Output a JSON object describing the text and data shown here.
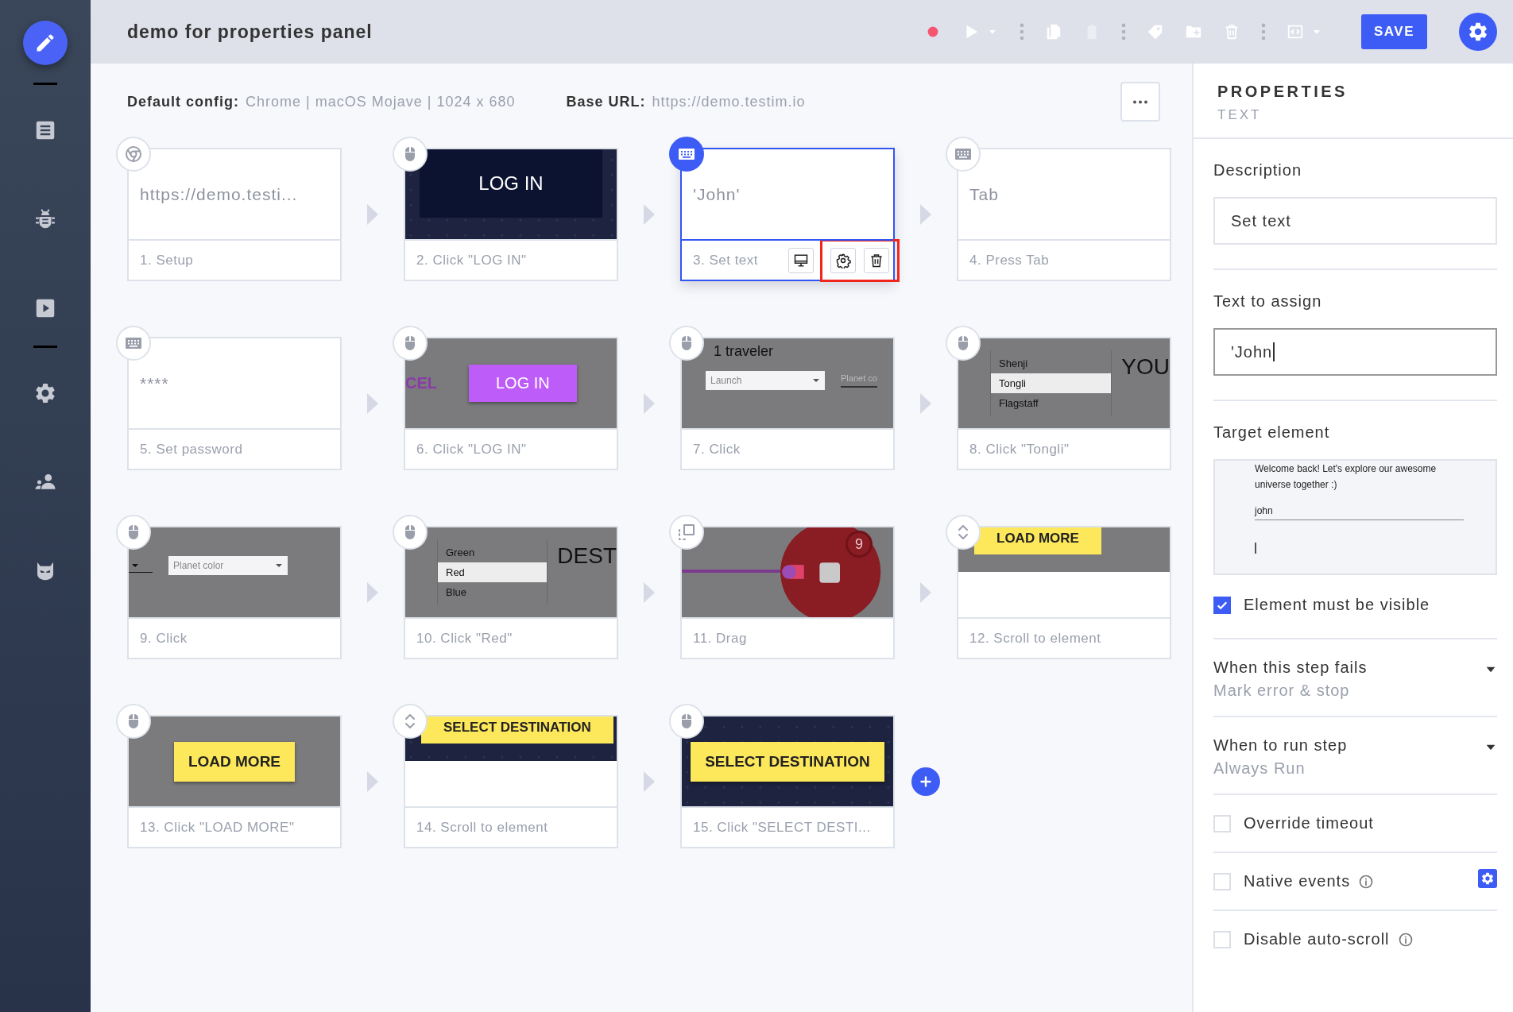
{
  "sidebar": {
    "groups": [
      [
        {
          "kind": "edit",
          "selected": true
        }
      ],
      [
        {
          "kind": "list",
          "selected": false
        },
        {
          "kind": "bug",
          "selected": false
        },
        {
          "kind": "run",
          "selected": false
        }
      ],
      [
        {
          "kind": "settings",
          "selected": false
        },
        {
          "kind": "team",
          "selected": false
        },
        {
          "kind": "mask",
          "selected": false
        }
      ]
    ]
  },
  "header": {
    "title": "demo for properties panel",
    "toolbar": [
      {
        "kind": "record",
        "disabled": false
      },
      {
        "kind": "play",
        "disabled": false
      },
      {
        "kind": "caret",
        "disabled": false
      },
      {
        "kind": "dots",
        "disabled": false
      },
      {
        "kind": "copy",
        "disabled": false
      },
      {
        "kind": "paste",
        "disabled": true
      },
      {
        "kind": "dots",
        "disabled": false
      },
      {
        "kind": "tag",
        "disabled": false
      },
      {
        "kind": "folder-add",
        "disabled": false
      },
      {
        "kind": "trash",
        "disabled": false
      },
      {
        "kind": "dots",
        "disabled": false
      },
      {
        "kind": "code",
        "disabled": false
      },
      {
        "kind": "caret",
        "disabled": false
      }
    ],
    "save_button": "SAVE",
    "properties_toggle": {
      "selected": true
    }
  },
  "config": {
    "default_label": "Default config:",
    "default_value": "Chrome | macOS Mojave | 1024 x 680",
    "base_label": "Base URL:",
    "base_value": "https://demo.testim.io"
  },
  "steps": [
    {
      "label": "1. Setup",
      "kind": "browser",
      "selected": false,
      "preview": {
        "kind": "text",
        "text": "https://demo.testi..."
      }
    },
    {
      "label": "2. Click \"LOG IN\"",
      "kind": "click",
      "selected": false,
      "preview": {
        "kind": "login_night",
        "button": "LOG IN"
      }
    },
    {
      "label": "3. Set text",
      "kind": "typing",
      "selected": true,
      "highlight_actions": true,
      "preview": {
        "kind": "text",
        "text": "'John'"
      }
    },
    {
      "label": "4. Press Tab",
      "kind": "typing",
      "selected": false,
      "preview": {
        "kind": "text",
        "text": "Tab"
      }
    },
    {
      "label": "5. Set password",
      "kind": "typing",
      "selected": false,
      "preview": {
        "kind": "text",
        "text": "****"
      }
    },
    {
      "label": "6. Click \"LOG IN\"",
      "kind": "click",
      "selected": false,
      "preview": {
        "kind": "login_purple",
        "side_text": "CEL",
        "button": "LOG IN"
      }
    },
    {
      "label": "7. Click",
      "kind": "click",
      "selected": false,
      "preview": {
        "kind": "form",
        "title": "1 traveler",
        "select": "Launch",
        "side_text": "Planet co",
        "cut_select": false
      }
    },
    {
      "label": "8. Click \"Tongli\"",
      "kind": "click",
      "selected": false,
      "preview": {
        "kind": "dropdown",
        "items": [
          {
            "text": "Shenji",
            "selected": false
          },
          {
            "text": "Tongli",
            "selected": true
          },
          {
            "text": "Flagstaff",
            "selected": false
          }
        ],
        "side_text": "YOU"
      }
    },
    {
      "label": "9. Click",
      "kind": "click",
      "selected": false,
      "preview": {
        "kind": "form",
        "select": "Planet color",
        "cut_select": true
      }
    },
    {
      "label": "10. Click \"Red\"",
      "kind": "click",
      "selected": false,
      "preview": {
        "kind": "dropdown",
        "items": [
          {
            "text": "Green",
            "selected": false
          },
          {
            "text": "Red",
            "selected": true
          },
          {
            "text": "Blue",
            "selected": false
          }
        ],
        "side_text": "DEST"
      }
    },
    {
      "label": "11. Drag",
      "kind": "drag",
      "selected": false,
      "preview": {
        "kind": "drag",
        "badge": "9"
      }
    },
    {
      "label": "12. Scroll to element",
      "kind": "scroll",
      "selected": false,
      "preview": {
        "kind": "scroll_gray",
        "text": "LOAD MORE"
      }
    },
    {
      "label": "13. Click \"LOAD MORE\"",
      "kind": "click",
      "selected": false,
      "preview": {
        "kind": "cta_gray",
        "button": "LOAD MORE"
      }
    },
    {
      "label": "14. Scroll to element",
      "kind": "scroll",
      "selected": false,
      "preview": {
        "kind": "scroll_night",
        "text": "SELECT DESTINATION"
      }
    },
    {
      "label": "15. Click \"SELECT DESTI...",
      "kind": "click",
      "selected": false,
      "preview": {
        "kind": "cta_night",
        "button": "SELECT DESTINATION"
      }
    }
  ],
  "properties": {
    "title": "PROPERTIES",
    "subtitle": "TEXT",
    "description": {
      "label": "Description",
      "value": "Set text"
    },
    "text_to_assign": {
      "label": "Text to assign",
      "value": "'John"
    },
    "target_element": {
      "label": "Target element",
      "preview": {
        "message": "Welcome back! Let's explore our awesome universe together :)",
        "field_value": "john"
      }
    },
    "element_visible": {
      "label": "Element must be visible",
      "checked": true
    },
    "dropdowns": [
      {
        "label": "When this step fails",
        "value": "Mark error & stop"
      },
      {
        "label": "When to run step",
        "value": "Always Run"
      }
    ],
    "options": [
      {
        "label": "Override timeout",
        "checked": false,
        "info": false,
        "settings": false
      },
      {
        "label": "Native events",
        "checked": false,
        "info": true,
        "settings": true
      },
      {
        "label": "Disable auto-scroll",
        "checked": false,
        "info": true,
        "settings": false
      }
    ]
  }
}
